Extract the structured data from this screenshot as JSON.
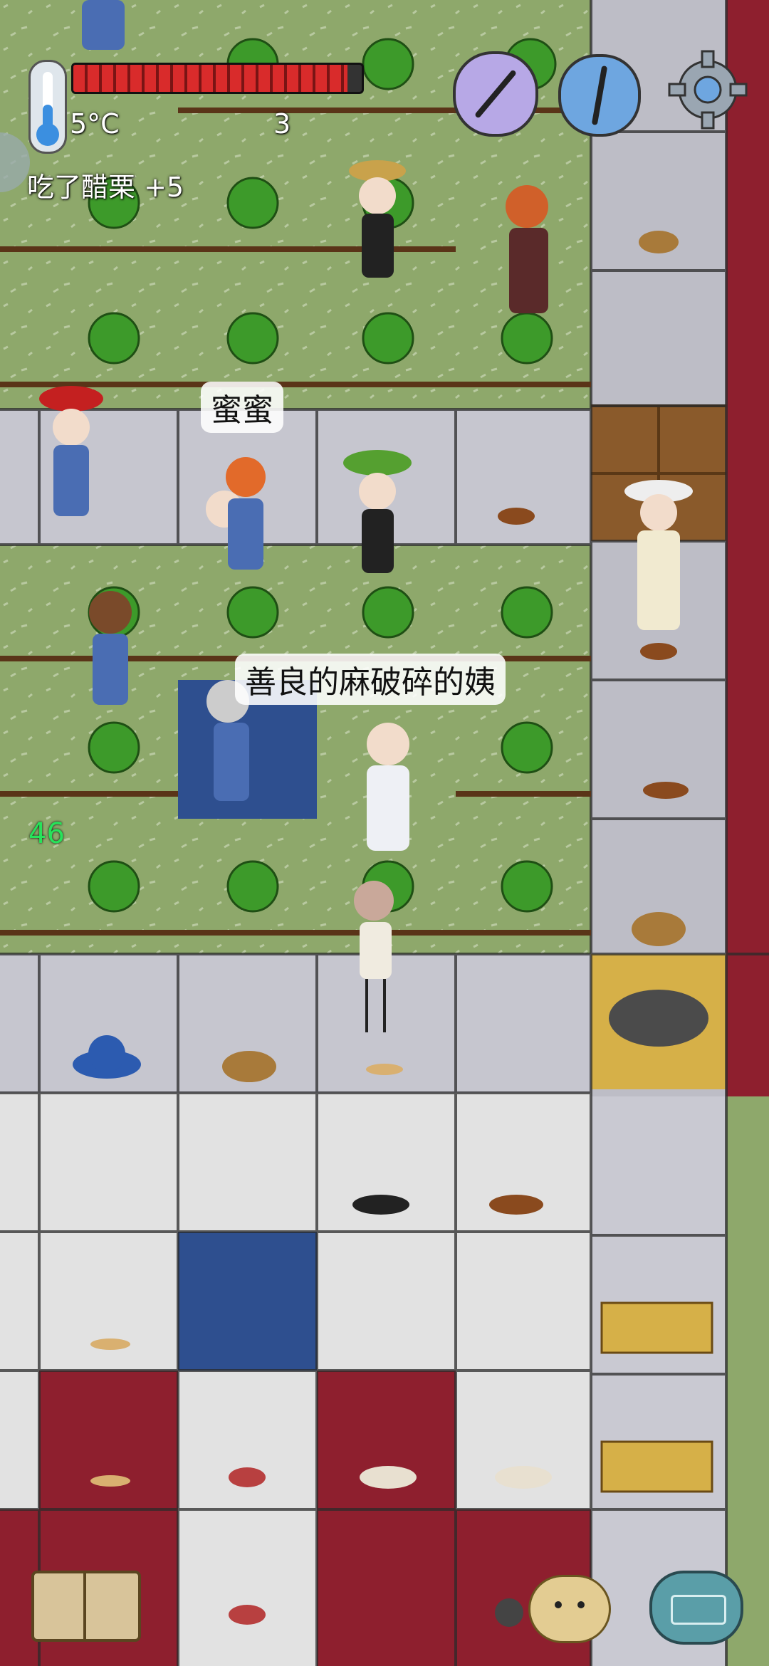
{
  "hud": {
    "temperature": "5°C",
    "food_count": "3",
    "message": "吃了醋栗 +5",
    "age_counter": "46",
    "food_pips_total": 20,
    "food_pips_filled": 19
  },
  "speech": {
    "bubble_1": "蜜蜜",
    "bubble_2": "善良的麻破碎的姨"
  },
  "controls": {
    "home_compass_icon": "home-compass-icon",
    "north_compass_icon": "compass-icon",
    "settings_icon": "gear-icon",
    "tech_book_icon": "book-icon",
    "emote_icon": "emote-face-icon",
    "keyboard_icon": "keyboard-icon"
  },
  "colors": {
    "grass": "#8fa86b",
    "stone": "#c9c9d2",
    "snow": "#e4e4e4",
    "red_carpet": "#8e1f2e",
    "blue_carpet": "#2e4f8f",
    "food_bar": "#d92b2b",
    "age_text": "#27e35a"
  }
}
